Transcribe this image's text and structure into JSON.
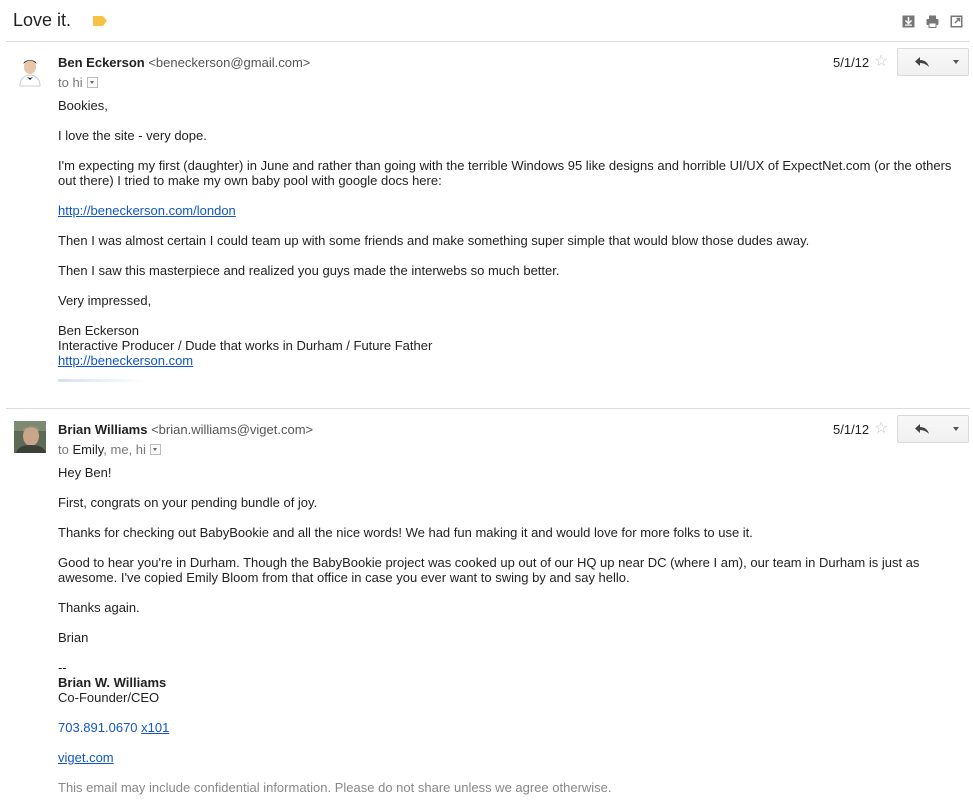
{
  "thread": {
    "subject": "Love it.",
    "label_color": "#f6c344"
  },
  "toolbar": {
    "icons": [
      "download-icon",
      "print-icon",
      "new-window-icon"
    ]
  },
  "messages": [
    {
      "sender_name": "Ben Eckerson",
      "sender_email": "<beneckerson@gmail.com>",
      "to_prefix": "to",
      "recipients": "hi",
      "date": "5/1/12",
      "body": {
        "greeting": "Bookies,",
        "p1": "I love the site - very dope.",
        "p2": "I'm expecting my first (daughter) in June and rather than going with the terrible Windows 95 like designs and horrible UI/UX of ExpectNet.com (or the others out there) I tried to make my own baby pool with google docs here:",
        "link1": "http://beneckerson.com/london",
        "p3": "Then I was almost certain I could team up with some friends and make something super simple that would blow those dudes away.",
        "p4": "Then I saw this masterpiece and realized you guys made the interwebs so much better.",
        "p5": "Very impressed,",
        "sig_name": "Ben Eckerson",
        "sig_title": "Interactive Producer / Dude that works in Durham / Future Father",
        "sig_link": "http://beneckerson.com"
      }
    },
    {
      "sender_name": "Brian Williams",
      "sender_email": "<brian.williams@viget.com>",
      "to_prefix": "to",
      "recipient_1": "Emily",
      "recipient_rest": ", me, hi",
      "date": "5/1/12",
      "body": {
        "greeting": "Hey Ben!",
        "p1": "First, congrats on your pending bundle of joy.",
        "p2": "Thanks for checking out BabyBookie and all the nice words!  We had fun making it and would love for more folks to use it.",
        "p3": "Good to hear you're in Durham.  Though the BabyBookie project was cooked up out of our HQ up near DC (where I am), our team in Durham is just as awesome.  I've copied Emily Bloom from that office in case you ever want to swing by and say hello.",
        "p4": "Thanks again.",
        "p5": "Brian",
        "sig_dash": "--",
        "sig_name": "Brian W. Williams",
        "sig_title": "Co-Founder/CEO",
        "phone": "703.891.0670",
        "ext": "x101",
        "site": "viget.com",
        "disclaimer": "This email may include confidential information. Please do not share unless we agree otherwise."
      }
    }
  ]
}
